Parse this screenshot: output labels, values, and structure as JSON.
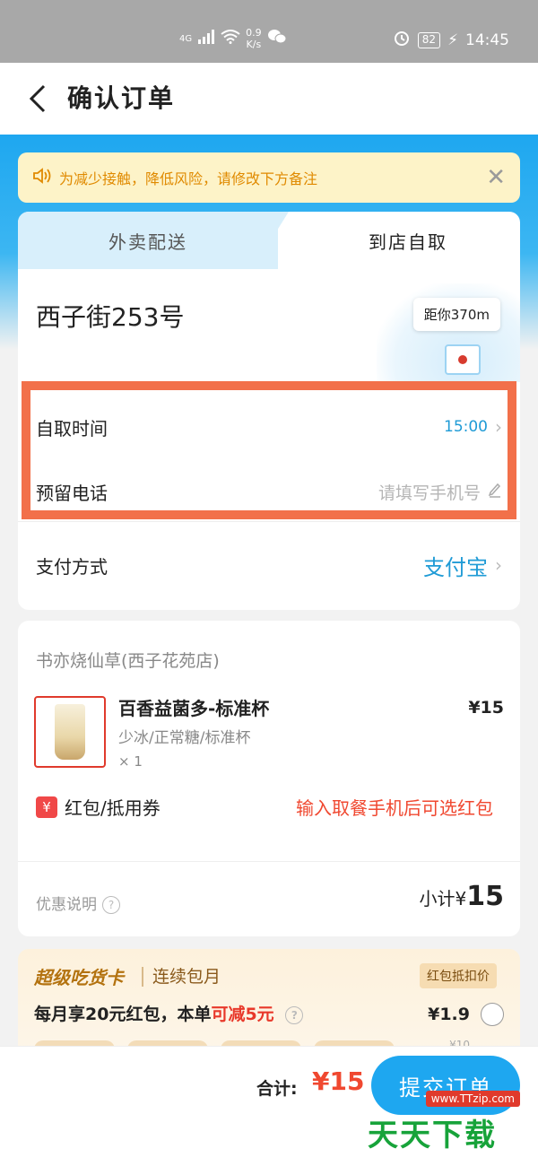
{
  "status_bar": {
    "network": "4G",
    "speed_value": "0.9",
    "speed_unit": "K/s",
    "battery": "82",
    "time": "14:45"
  },
  "header": {
    "title": "确认订单"
  },
  "notice": {
    "text": "为减少接触，降低风险，请修改下方备注"
  },
  "tabs": {
    "delivery": "外卖配送",
    "pickup": "到店自取"
  },
  "store": {
    "address": "西子街253号",
    "distance": "距你370m"
  },
  "pickup": {
    "time_label": "自取时间",
    "time_value": "15:00",
    "phone_label": "预留电话",
    "phone_placeholder": "请填写手机号"
  },
  "payment": {
    "label": "支付方式",
    "method": "支付宝"
  },
  "order": {
    "shop_name": "书亦烧仙草(西子花苑店)",
    "item": {
      "name": "百香益菌多-标准杯",
      "spec": "少冰/正常糖/标准杯",
      "qty": "× 1",
      "price": "¥15"
    },
    "coupon_badge": "¥",
    "coupon_label": "红包/抵用券",
    "coupon_hint": "输入取餐手机后可选红包",
    "discount_label": "优惠说明",
    "subtotal_label": "小计¥",
    "subtotal_value": "15"
  },
  "promo": {
    "brand": "超级吃货卡",
    "subtitle": "连续包月",
    "tag": "红包抵扣价",
    "line_prefix": "每月享20元红包，本单",
    "line_highlight": "可减5元",
    "price": "¥1.9",
    "original_price": "¥10"
  },
  "bottom": {
    "total_label": "合计:",
    "total_value": "¥15",
    "submit": "提交订单"
  },
  "watermark": {
    "url": "www.TTzip.com",
    "text": "天天下载"
  },
  "colors": {
    "accent": "#1ea7f0",
    "highlight_border": "#f2704a",
    "price_red": "#f04830",
    "notice_bg": "#fdf3c8"
  }
}
